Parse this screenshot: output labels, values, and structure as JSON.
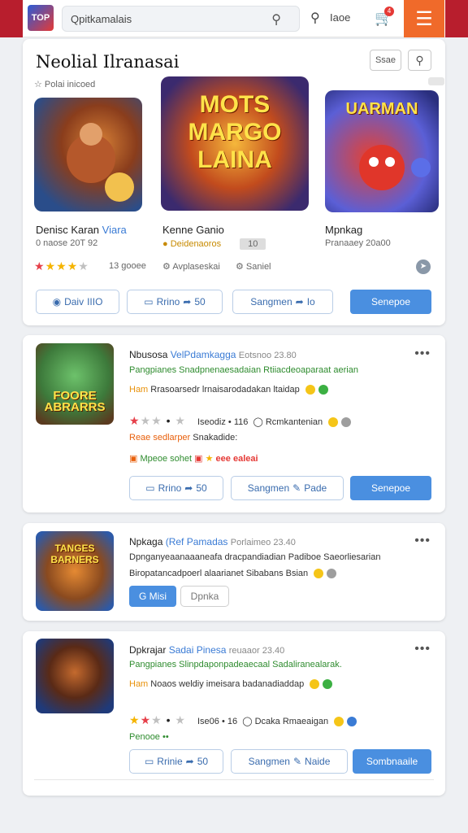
{
  "header": {
    "logo_text": "TOP",
    "search_text": "Qpitkamalais",
    "secondary_label": "Iaoe",
    "cart_count": "4",
    "menu_icon": "hamburger-icon"
  },
  "featured": {
    "title": "Neolial Ilranasai",
    "filter_label": "Ssae",
    "subtitle": "Polai inicoed",
    "games": [
      {
        "name": "Denisc Karan",
        "name_accent": "Viara",
        "meta": "0 naose 20T 92",
        "rating_text": "13 gooee",
        "thumb_text": "",
        "rating": 3.5
      },
      {
        "name": "Kenne Ganio",
        "meta": "Deidenaoros",
        "meta_badge": "10",
        "info": "Avplaseskai",
        "thumb_text": "MOTS MARGO LAINA"
      },
      {
        "name": "Mpnkag",
        "meta": "Pranaaey 20a00",
        "info": "Saniel",
        "thumb_text": "UARMAN"
      }
    ],
    "buttons": {
      "b1": "Daiv",
      "b1_num": "IIIO",
      "b2": "Rrino",
      "b2_num": "50",
      "b3": "Sangmen",
      "b3_num": "Io",
      "primary": "Senepoe"
    }
  },
  "items": [
    {
      "title": "Nbusosa",
      "title_blue": "VelPdamkagga",
      "title_grey": "Eotsnoo 23.80",
      "line_green": "Pangpianes Snadpnenaesadaian Rtiiacdeoaparaat aerian",
      "line_dark_tag": "Ham",
      "line_dark": "Rrasoarsedr lrnaisarodadakan ltaidap",
      "rating_text": "Iseodiz • 116",
      "rating_extra": "Rcmkantenian",
      "rating": 2,
      "promo_orange": "Reae sedlarper",
      "promo_tail": "Snakadide:",
      "promo_green": "Mpeoe sohet",
      "promo_red": "eee ealeai",
      "thumb_text": "FOORE ABRARRS",
      "buttons": {
        "b1": "Rrino",
        "b1_num": "50",
        "b2": "Sangmen",
        "b2_tail": "Pade",
        "primary": "Senepoe"
      }
    },
    {
      "title": "Npkaga",
      "title_blue": "(Ref Pamadas",
      "title_grey": "Porlaimeo 23.40",
      "line_dark_1": "Dpnganyeaanaaaneafa dracpandiadian Padiboe Saeorliesarian",
      "line_dark_2": "Biropatancadpoerl alaarianet Sibabans Bsian",
      "thumb_text": "TANGES BARNERS",
      "buttons": {
        "b1": "Misi",
        "b2": "Dpnka"
      }
    },
    {
      "title": "Dpkrajar",
      "title_blue": "Sadai Pinesa",
      "title_grey": "reuaaor 23.40",
      "line_green": "Pangpianes Slinpdaponpadeaecaal Sadaliranealarak.",
      "line_dark_tag": "Ham",
      "line_dark": "Noaos weldiy imeisara badanadiaddap",
      "rating_text": "Ise06 • 16",
      "rating_extra": "Dcaka Rmaeaigan",
      "rating": 2,
      "promo_green": "Penooe",
      "thumb_text": "",
      "buttons": {
        "b1": "Rrinie",
        "b1_num": "50",
        "b2": "Sangmen",
        "b2_tail": "Naide",
        "primary": "Sombnaaile"
      }
    }
  ],
  "colors": {
    "accent_orange": "#f06a2a",
    "primary_blue": "#4a8fe0",
    "brand_red": "#b81e2d",
    "star_red": "#e6404a"
  }
}
